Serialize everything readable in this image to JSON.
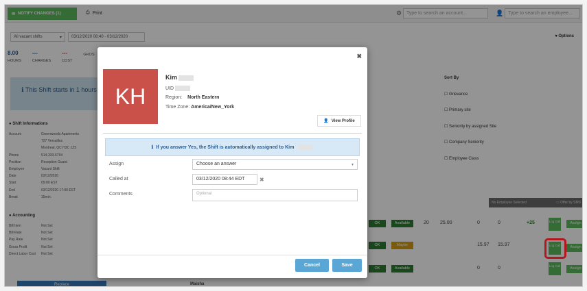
{
  "topbar": {
    "notify_label": "NOTIFY CHANGES (1)",
    "print_label": "Print",
    "account_search_placeholder": "Type to search an account...",
    "employee_search_placeholder": "Type to search an employee..."
  },
  "filters": {
    "shift_filter": "All vacant shifts",
    "date_range": "03/12/2020 08:40 - 03/12/2020",
    "options_label": "▾ Options"
  },
  "stats": [
    {
      "value": "8.00",
      "label": "HOURS"
    },
    {
      "value": "---",
      "label": "CHARGES"
    },
    {
      "value": "---",
      "label": "COST"
    },
    {
      "value": "",
      "label": "GROS"
    }
  ],
  "shift_notice": "This Shift starts in 1 hours",
  "shift_info": {
    "title": "Shift Informations",
    "rows": [
      {
        "k": "Account",
        "v": "Greenwoods Apartments"
      },
      {
        "k": "",
        "v": "727 Versailles"
      },
      {
        "k": "",
        "v": "Montreal, QC H3C 1Z5"
      },
      {
        "k": "Phone",
        "v": "514-333-6794"
      },
      {
        "k": "Position",
        "v": "Reception Guard"
      },
      {
        "k": "Employee",
        "v": "Vacant Shift"
      },
      {
        "k": "Date",
        "v": "03/12/2020"
      },
      {
        "k": "Start",
        "v": "09:00 EST"
      },
      {
        "k": "End",
        "v": "03/12/2020 17:00 EST"
      },
      {
        "k": "Break",
        "v": "15min."
      }
    ]
  },
  "accounting": {
    "title": "Accounting",
    "rows": [
      {
        "k": "Bill Item",
        "v": "Not Set"
      },
      {
        "k": "Bill Rate",
        "v": "Not Set"
      },
      {
        "k": "Pay Rate",
        "v": "Not Set"
      },
      {
        "k": "Gross Profit",
        "v": "Not Set"
      },
      {
        "k": "Direct Labor Cost",
        "v": "Not Set"
      }
    ]
  },
  "replace_label": "Replace",
  "sort": {
    "title": "Sort By",
    "items": [
      "Grievance",
      "Primary site",
      "Seniority by assigned Site",
      "Company Seniority",
      "Employee Class"
    ]
  },
  "grid": {
    "no_employee_label": "No Employee Selected",
    "offer_sms_label": "Offer by SMS",
    "rows": [
      {
        "ok": "OK",
        "status": "Available",
        "a": "20",
        "b": "25.00",
        "c": "0",
        "d": "0",
        "e": "+25"
      },
      {
        "ok": "OK",
        "status": "Maybe",
        "a": "",
        "b": "",
        "c": "15.97",
        "d": "15.97",
        "e": ""
      },
      {
        "ok": "OK",
        "status": "Available",
        "a": "",
        "b": "",
        "c": "0",
        "d": "0",
        "e": ""
      }
    ],
    "log_call_label": "Log Call",
    "assign_label": "Assign",
    "bottom_name": "Maisha"
  },
  "modal": {
    "initials": "KH",
    "name": "Kim",
    "uid_label": "UID",
    "region_label": "Region:",
    "region_value": "North Eastern",
    "timezone_label": "Time Zone:",
    "timezone_value": "America/New_York",
    "view_profile_label": "View Profile",
    "alert_text": "If you answer Yes, the Shift is automatically assigned to Kim",
    "assign_label": "Assign",
    "assign_value": "Choose an answer",
    "called_at_label": "Called at",
    "called_at_value": "03/12/2020 08:44 EDT",
    "comments_label": "Comments",
    "comments_placeholder": "Optional",
    "cancel_label": "Cancel",
    "save_label": "Save"
  },
  "colors": {
    "accent_blue": "#5aa7d6",
    "green": "#5cb85c",
    "avatar_red": "#c9514a",
    "highlight_red": "#b3171d"
  }
}
